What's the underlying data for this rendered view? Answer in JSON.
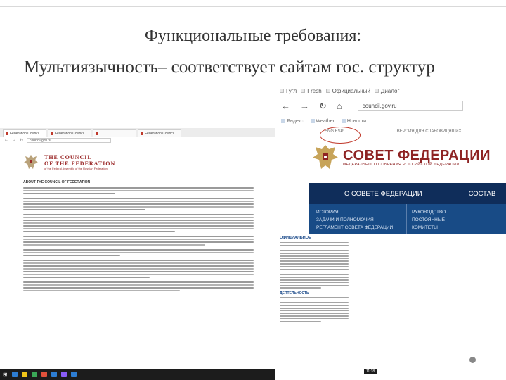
{
  "slide": {
    "title_line1": "Функциональные требования:",
    "title_line2": "Мультиязычность– соответствует сайтам гос. структур"
  },
  "left_screenshot": {
    "tabs": [
      "Federation Council",
      "Federation Council",
      "",
      "Federation Council"
    ],
    "address": "council.gov.ru",
    "logo_text_line1": "THE COUNCIL",
    "logo_text_line2": "OF THE FEDERATION",
    "logo_text_line3": "of the Federal Assembly of the Russian Federation",
    "heading": "ABOUT THE COUNCIL OF FEDERATION",
    "paragraph_line_counts": [
      3,
      5,
      7,
      4,
      3,
      7,
      4
    ],
    "taskbar_icon_colors": [
      "#2d7dd2",
      "#f0c419",
      "#3aa757",
      "#e0513b",
      "#2d7dd2",
      "#8a5cf6",
      "#2d7dd2"
    ]
  },
  "right_screenshot": {
    "tabs": [
      "Гугл",
      "Fresh",
      "Официальный",
      "Диалог"
    ],
    "nav_icons": [
      "back-arrow",
      "forward-arrow",
      "refresh",
      "home",
      "star"
    ],
    "address": "council.gov.ru",
    "bookmarks": [
      "Яндекс",
      "Weather",
      "Новости"
    ],
    "lang_row": "ENG  ESP",
    "lang_row_right": "ВЕРСИЯ ДЛЯ СЛАБОВИДЯЩИХ",
    "logo_title": "СОВЕТ ФЕДЕРАЦИИ",
    "logo_subtitle": "ФЕДЕРАЛЬНОГО СОБРАНИЯ РОССИЙСКОЙ ФЕДЕРАЦИИ",
    "menu": [
      "О СОВЕТЕ ФЕДЕРАЦИИ",
      "СОСТАВ"
    ],
    "submenu_left": [
      "ИСТОРИЯ",
      "ЗАДАЧИ И ПОЛНОМОЧИЯ",
      "РЕГЛАМЕНТ СОВЕТА ФЕДЕРАЦИИ"
    ],
    "submenu_right": [
      "РУКОВОДСТВО",
      "ПОСТОЯННЫЕ",
      "КОМИТЕТЫ"
    ],
    "panel_title": "ОФИЦИАЛЬНОЕ",
    "panel_label": "ДЕЯТЕЛЬНОСТЬ",
    "panel_line_counts": [
      18,
      10
    ],
    "time": "11:18"
  },
  "colors": {
    "council_red": "#8e2323",
    "menu_navy": "#0f2d5a",
    "submenu_blue": "#184b86",
    "ellipse_red": "#c0392b"
  }
}
